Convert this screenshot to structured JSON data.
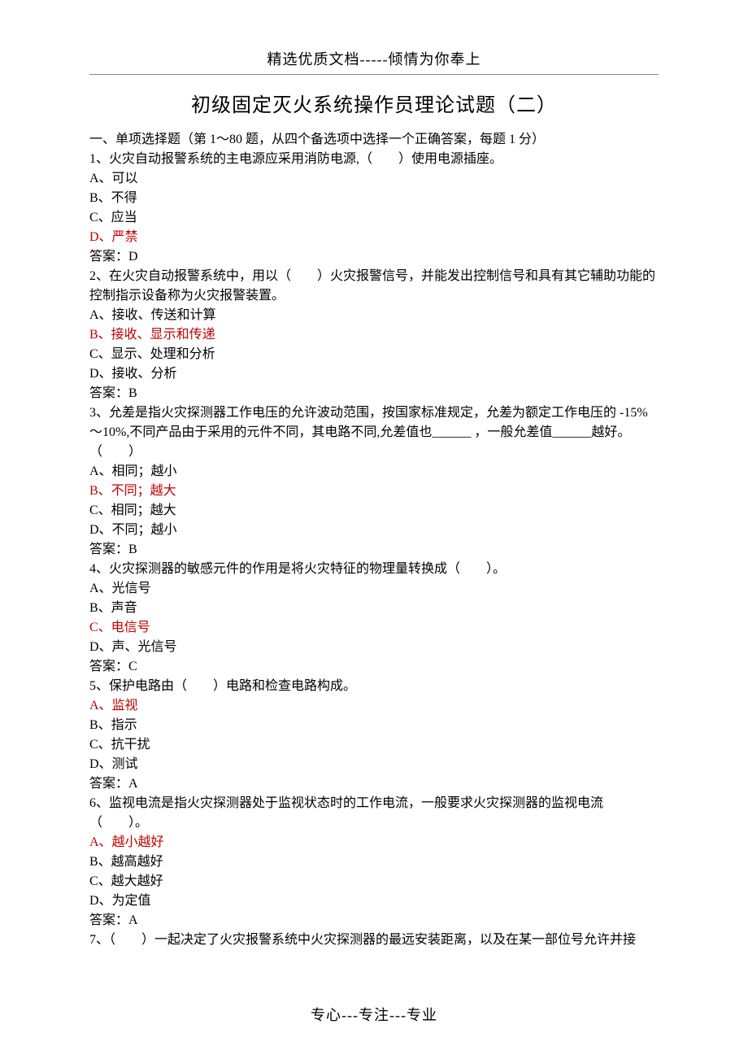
{
  "header": "精选优质文档-----倾情为你奉上",
  "title": "初级固定灭火系统操作员理论试题（二）",
  "section_intro": "一、单项选择题（第 1～80 题，从四个备选项中选择一个正确答案，每题 1 分）",
  "questions": [
    {
      "stem": "1、火灾自动报警系统的主电源应采用消防电源,（　　）使用电源插座。",
      "options": [
        {
          "text": "A、可以",
          "correct": false
        },
        {
          "text": "B、不得",
          "correct": false
        },
        {
          "text": "C、应当",
          "correct": false
        },
        {
          "text": "D、严禁",
          "correct": true
        }
      ],
      "answer": "答案：D"
    },
    {
      "stem": "2、在火灾自动报警系统中，用以（　　）火灾报警信号，并能发出控制信号和具有其它辅助功能的控制指示设备称为火灾报警装置。",
      "options": [
        {
          "text": "A、接收、传送和计算",
          "correct": false
        },
        {
          "text": "B、接收、显示和传递",
          "correct": true
        },
        {
          "text": "C、显示、处理和分析",
          "correct": false
        },
        {
          "text": "D、接收、分析",
          "correct": false
        }
      ],
      "answer": "答案：B"
    },
    {
      "stem": "3、允差是指火灾探测器工作电压的允许波动范围，按国家标准规定，允差为额定工作电压的 -15%～10%,不同产品由于采用的元件不同，其电路不同,允差值也______ ，一般允差值______越好。（　　）",
      "options": [
        {
          "text": "A、相同；越小",
          "correct": false
        },
        {
          "text": "B、不同；越大",
          "correct": true
        },
        {
          "text": "C、相同；越大",
          "correct": false
        },
        {
          "text": "D、不同；越小",
          "correct": false
        }
      ],
      "answer": "答案：B"
    },
    {
      "stem": "4、火灾探测器的敏感元件的作用是将火灾特征的物理量转换成（　　）。",
      "options": [
        {
          "text": "A、光信号",
          "correct": false
        },
        {
          "text": "B、声音",
          "correct": false
        },
        {
          "text": "C、电信号",
          "correct": true
        },
        {
          "text": "D、声、光信号",
          "correct": false
        }
      ],
      "answer": "答案：C"
    },
    {
      "stem": "5、保护电路由（　　）电路和检查电路构成。",
      "options": [
        {
          "text": "A、监视",
          "correct": true
        },
        {
          "text": "B、指示",
          "correct": false
        },
        {
          "text": "C、抗干扰",
          "correct": false
        },
        {
          "text": "D、测试",
          "correct": false
        }
      ],
      "answer": "答案：A"
    },
    {
      "stem": "6、监视电流是指火灾探测器处于监视状态时的工作电流，一般要求火灾探测器的监视电流\n（　　）。",
      "options": [
        {
          "text": "A、越小越好",
          "correct": true
        },
        {
          "text": "B、越高越好",
          "correct": false
        },
        {
          "text": "C、越大越好",
          "correct": false
        },
        {
          "text": "D、为定值",
          "correct": false
        }
      ],
      "answer": "答案：A"
    },
    {
      "stem": "7、（　　）一起决定了火灾报警系统中火灾探测器的最远安装距离，以及在某一部位号允许并接",
      "options": [],
      "answer": ""
    }
  ],
  "footer": "专心---专注---专业"
}
